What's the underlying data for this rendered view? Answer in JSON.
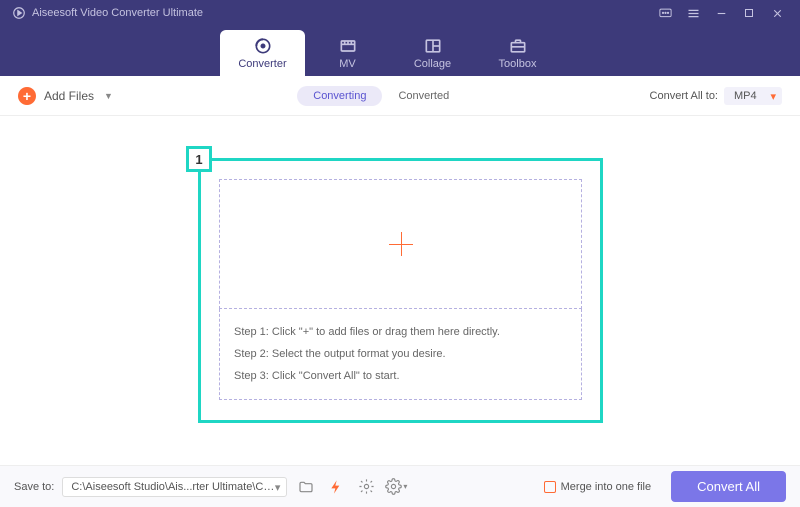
{
  "app": {
    "title": "Aiseesoft Video Converter Ultimate"
  },
  "tabs": {
    "converter": "Converter",
    "mv": "MV",
    "collage": "Collage",
    "toolbox": "Toolbox"
  },
  "toolbar": {
    "addFiles": "Add Files",
    "converting": "Converting",
    "converted": "Converted",
    "convertAllTo": "Convert All to:",
    "format": "MP4"
  },
  "callout": {
    "num": "1"
  },
  "steps": {
    "s1": "Step 1: Click \"+\" to add files or drag them here directly.",
    "s2": "Step 2: Select the output format you desire.",
    "s3": "Step 3: Click \"Convert All\" to start."
  },
  "footer": {
    "saveTo": "Save to:",
    "path": "C:\\Aiseesoft Studio\\Ais...rter Ultimate\\Converted",
    "merge": "Merge into one file",
    "convertAll": "Convert All"
  }
}
